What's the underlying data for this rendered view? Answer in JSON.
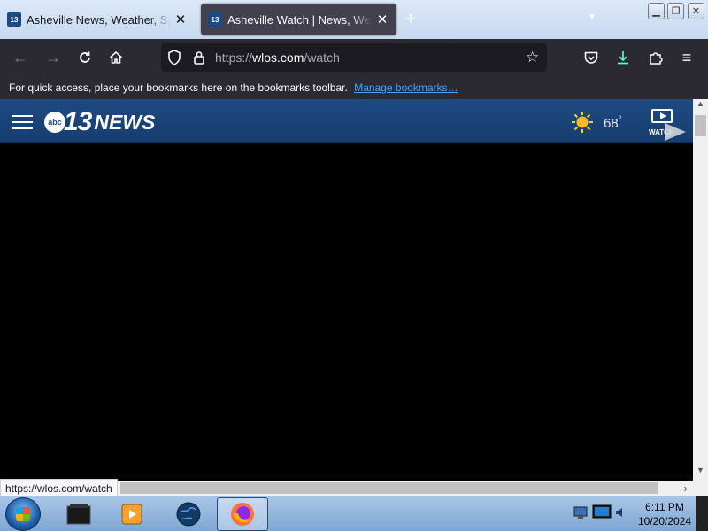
{
  "browser": {
    "tabs": [
      {
        "favicon": "wlos-13-favicon",
        "title": "Asheville News, Weather, Sports",
        "active": false
      },
      {
        "favicon": "wlos-13-favicon",
        "title": "Asheville Watch | News, Weather",
        "active": true
      }
    ],
    "favicon_text": "13",
    "url": {
      "prefix": "https://",
      "host": "wlos.com",
      "path": "/watch"
    },
    "bookmarks_bar": {
      "message": "For quick access, place your bookmarks here on the bookmarks toolbar.",
      "link": "Manage bookmarks…"
    },
    "status_url": "https://wlos.com/watch"
  },
  "site": {
    "logo": {
      "network": "abc",
      "number": "13",
      "word": "NEWS"
    },
    "weather": {
      "icon": "sun-icon",
      "temperature": "68",
      "unit": "°"
    },
    "watch_label": "WATCH"
  },
  "taskbar": {
    "items": [
      "file-explorer-icon",
      "media-player-icon",
      "globe-icon",
      "firefox-icon"
    ],
    "tray": [
      "network-icon",
      "volume-icon"
    ],
    "time": "6:11 PM",
    "date": "10/20/2024"
  },
  "colors": {
    "header_blue": "#1e4a82",
    "tab_active": "#42414d",
    "toolbar": "#2b2a33",
    "link_blue": "#45a1ff"
  }
}
